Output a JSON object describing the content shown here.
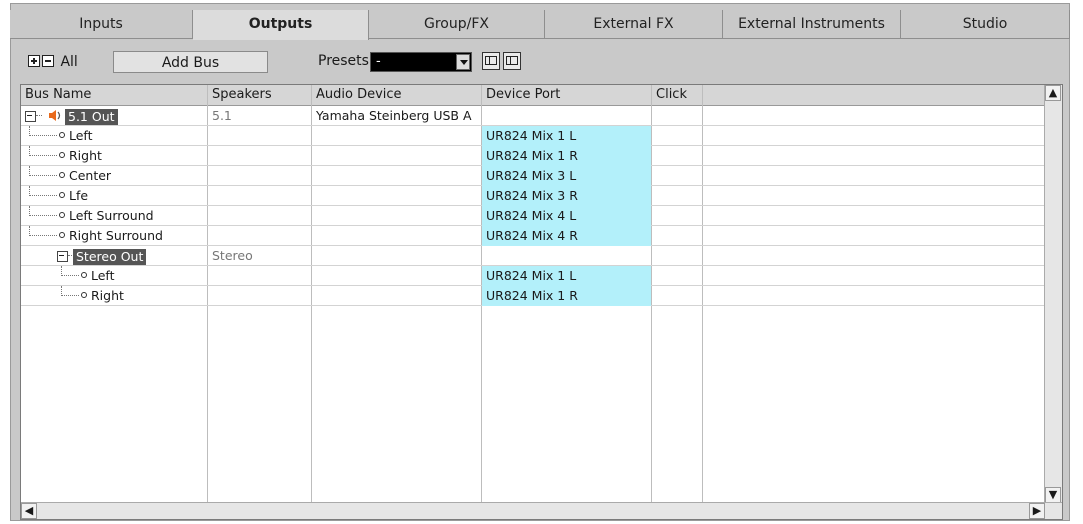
{
  "tabs": [
    "Inputs",
    "Outputs",
    "Group/FX",
    "External FX",
    "External Instruments",
    "Studio"
  ],
  "active_tab": "Outputs",
  "toolbar": {
    "expand_all_label": "All",
    "add_bus_label": "Add Bus",
    "presets_label": "Presets",
    "presets_value": "-"
  },
  "columns": [
    "Bus Name",
    "Speakers",
    "Audio Device",
    "Device Port",
    "Click"
  ],
  "rows": [
    {
      "type": "bus",
      "name": "5.1 Out",
      "speakers": "5.1",
      "device": "Yamaha Steinberg USB A",
      "port": "",
      "click": ""
    },
    {
      "type": "child",
      "name": "Left",
      "port": "UR824 Mix 1 L"
    },
    {
      "type": "child",
      "name": "Right",
      "port": "UR824 Mix 1 R"
    },
    {
      "type": "child",
      "name": "Center",
      "port": "UR824 Mix 3 L"
    },
    {
      "type": "child",
      "name": "Lfe",
      "port": "UR824 Mix 3 R"
    },
    {
      "type": "child",
      "name": "Left Surround",
      "port": "UR824 Mix 4 L"
    },
    {
      "type": "child",
      "name": "Right Surround",
      "port": "UR824 Mix 4 R"
    },
    {
      "type": "bus",
      "name": "Stereo Out",
      "speakers": "Stereo",
      "device": "",
      "port": "",
      "click": ""
    },
    {
      "type": "child2",
      "name": "Left",
      "port": "UR824 Mix 1 L"
    },
    {
      "type": "child2",
      "name": "Right",
      "port": "UR824 Mix 1 R"
    }
  ],
  "colors": {
    "port_highlight": "#b3f0fa",
    "selected_bus": "#555555"
  },
  "icons": [
    "expand-all-icon",
    "collapse-all-icon",
    "speaker-icon",
    "connector-icon",
    "save-preset-icon",
    "delete-preset-icon"
  ]
}
